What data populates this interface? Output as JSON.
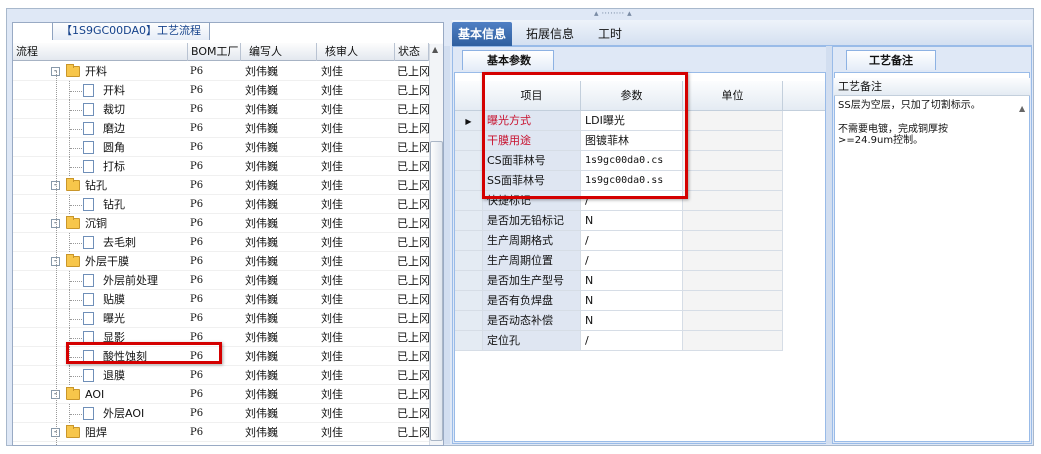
{
  "left_panel": {
    "title": "【1S9GC00DA0】工艺流程",
    "columns": [
      "流程",
      "BOM工厂",
      "编写人",
      "核审人",
      "状态"
    ],
    "rows": [
      {
        "level": 1,
        "type": "folder",
        "expander": "-",
        "name": "开料",
        "bom": "P6",
        "author": "刘伟巍",
        "reviewer": "刘佳",
        "status": "已上冈"
      },
      {
        "level": 2,
        "type": "doc",
        "name": "开料",
        "bom": "P6",
        "author": "刘伟巍",
        "reviewer": "刘佳",
        "status": "已上冈"
      },
      {
        "level": 2,
        "type": "doc",
        "name": "裁切",
        "bom": "P6",
        "author": "刘伟巍",
        "reviewer": "刘佳",
        "status": "已上冈"
      },
      {
        "level": 2,
        "type": "doc",
        "name": "磨边",
        "bom": "P6",
        "author": "刘伟巍",
        "reviewer": "刘佳",
        "status": "已上冈"
      },
      {
        "level": 2,
        "type": "doc",
        "name": "圆角",
        "bom": "P6",
        "author": "刘伟巍",
        "reviewer": "刘佳",
        "status": "已上冈"
      },
      {
        "level": 2,
        "type": "doc",
        "name": "打标",
        "bom": "P6",
        "author": "刘伟巍",
        "reviewer": "刘佳",
        "status": "已上冈"
      },
      {
        "level": 1,
        "type": "folder",
        "expander": "-",
        "name": "钻孔",
        "bom": "P6",
        "author": "刘伟巍",
        "reviewer": "刘佳",
        "status": "已上冈"
      },
      {
        "level": 2,
        "type": "doc",
        "name": "钻孔",
        "bom": "P6",
        "author": "刘伟巍",
        "reviewer": "刘佳",
        "status": "已上冈"
      },
      {
        "level": 1,
        "type": "folder",
        "expander": "-",
        "name": "沉铜",
        "bom": "P6",
        "author": "刘伟巍",
        "reviewer": "刘佳",
        "status": "已上冈"
      },
      {
        "level": 2,
        "type": "doc",
        "name": "去毛刺",
        "bom": "P6",
        "author": "刘伟巍",
        "reviewer": "刘佳",
        "status": "已上冈"
      },
      {
        "level": 1,
        "type": "folder",
        "expander": "-",
        "name": "外层干膜",
        "bom": "P6",
        "author": "刘伟巍",
        "reviewer": "刘佳",
        "status": "已上冈"
      },
      {
        "level": 2,
        "type": "doc",
        "name": "外层前处理",
        "bom": "P6",
        "author": "刘伟巍",
        "reviewer": "刘佳",
        "status": "已上冈"
      },
      {
        "level": 2,
        "type": "doc",
        "name": "贴膜",
        "bom": "P6",
        "author": "刘伟巍",
        "reviewer": "刘佳",
        "status": "已上冈"
      },
      {
        "level": 2,
        "type": "doc",
        "name": "曝光",
        "bom": "P6",
        "author": "刘伟巍",
        "reviewer": "刘佳",
        "status": "已上冈"
      },
      {
        "level": 2,
        "type": "doc",
        "name": "显影",
        "bom": "P6",
        "author": "刘伟巍",
        "reviewer": "刘佳",
        "status": "已上冈"
      },
      {
        "level": 2,
        "type": "doc",
        "name": "酸性蚀刻",
        "bom": "P6",
        "author": "刘伟巍",
        "reviewer": "刘佳",
        "status": "已上冈"
      },
      {
        "level": 2,
        "type": "doc",
        "name": "退膜",
        "bom": "P6",
        "author": "刘伟巍",
        "reviewer": "刘佳",
        "status": "已上冈"
      },
      {
        "level": 1,
        "type": "folder",
        "expander": "-",
        "name": "AOI",
        "bom": "P6",
        "author": "刘伟巍",
        "reviewer": "刘佳",
        "status": "已上冈"
      },
      {
        "level": 2,
        "type": "doc",
        "name": "外层AOI",
        "bom": "P6",
        "author": "刘伟巍",
        "reviewer": "刘佳",
        "status": "已上冈"
      },
      {
        "level": 1,
        "type": "folder",
        "expander": "-",
        "name": "阻焊",
        "bom": "P6",
        "author": "刘伟巍",
        "reviewer": "刘佳",
        "status": "已上冈"
      }
    ]
  },
  "tabs": [
    "基本信息",
    "拓展信息",
    "工时"
  ],
  "middle_panel": {
    "subtab": "基本参数",
    "columns": [
      "项目",
      "参数",
      "单位"
    ],
    "rows": [
      {
        "key": "曝光方式",
        "value": "LDI曝光",
        "unit": "",
        "highlight": true
      },
      {
        "key": "干膜用途",
        "value": "图镀菲林",
        "unit": "",
        "highlight": true
      },
      {
        "key": "CS面菲林号",
        "value": "1s9gc00da0.cs",
        "unit": "",
        "highlight": false
      },
      {
        "key": "SS面菲林号",
        "value": "1s9gc00da0.ss",
        "unit": "",
        "highlight": false
      },
      {
        "key": "快捷标记",
        "value": "/",
        "unit": "",
        "highlight": false
      },
      {
        "key": "是否加无铅标记",
        "value": "N",
        "unit": "",
        "highlight": false
      },
      {
        "key": "生产周期格式",
        "value": "/",
        "unit": "",
        "highlight": false
      },
      {
        "key": "生产周期位置",
        "value": "/",
        "unit": "",
        "highlight": false
      },
      {
        "key": "是否加生产型号",
        "value": "N",
        "unit": "",
        "highlight": false
      },
      {
        "key": "是否有负焊盘",
        "value": "N",
        "unit": "",
        "highlight": false
      },
      {
        "key": "是否动态补偿",
        "value": "N",
        "unit": "",
        "highlight": false
      },
      {
        "key": "定位孔",
        "value": "/",
        "unit": "",
        "highlight": false
      }
    ],
    "current_row_marker": "▶"
  },
  "right_panel": {
    "tab": "工艺备注",
    "header": "工艺备注",
    "lines": [
      "SS层为空层，只加了切割标示。",
      "",
      "不需要电镀，完成铜厚按",
      ">=24.9um控制。"
    ]
  },
  "colors": {
    "highlight_red": "#d40000",
    "active_tab": "#3a6bb0",
    "key_text_red": "#c8102e"
  }
}
